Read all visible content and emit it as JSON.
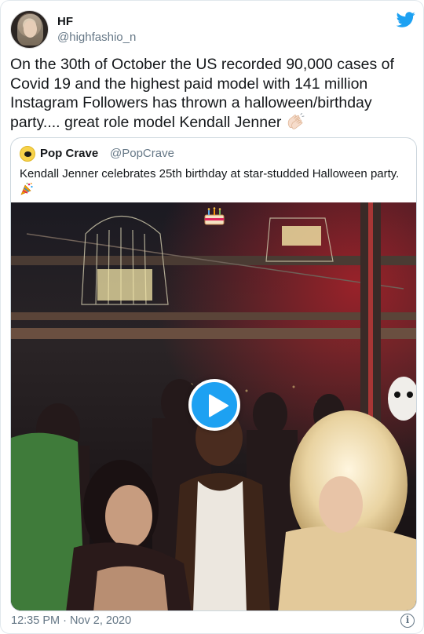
{
  "tweet": {
    "author_name": "HF",
    "author_handle": "@highfashio_n",
    "text": "On the 30th of October the US recorded 90,000 cases of Covid 19 and the highest paid model with 141 million Instagram Followers has thrown a halloween/birthday party.... great role model Kendall Jenner",
    "text_emoji": "clapping-hands-emoji",
    "timestamp": "12:35 PM · Nov 2, 2020",
    "info_icon_glyph": "i"
  },
  "quoted_tweet": {
    "author_name": "Pop Crave",
    "author_handle": "@PopCrave",
    "text": "Kendall Jenner celebrates 25th birthday at star-studded Halloween party.",
    "text_emoji": "party-popper-emoji",
    "media": {
      "type": "video",
      "overlay_emoji": "birthday-cake-emoji"
    }
  },
  "colors": {
    "twitter_blue": "#1da1f2",
    "secondary_text": "#657786",
    "border": "#ccd6dd"
  }
}
